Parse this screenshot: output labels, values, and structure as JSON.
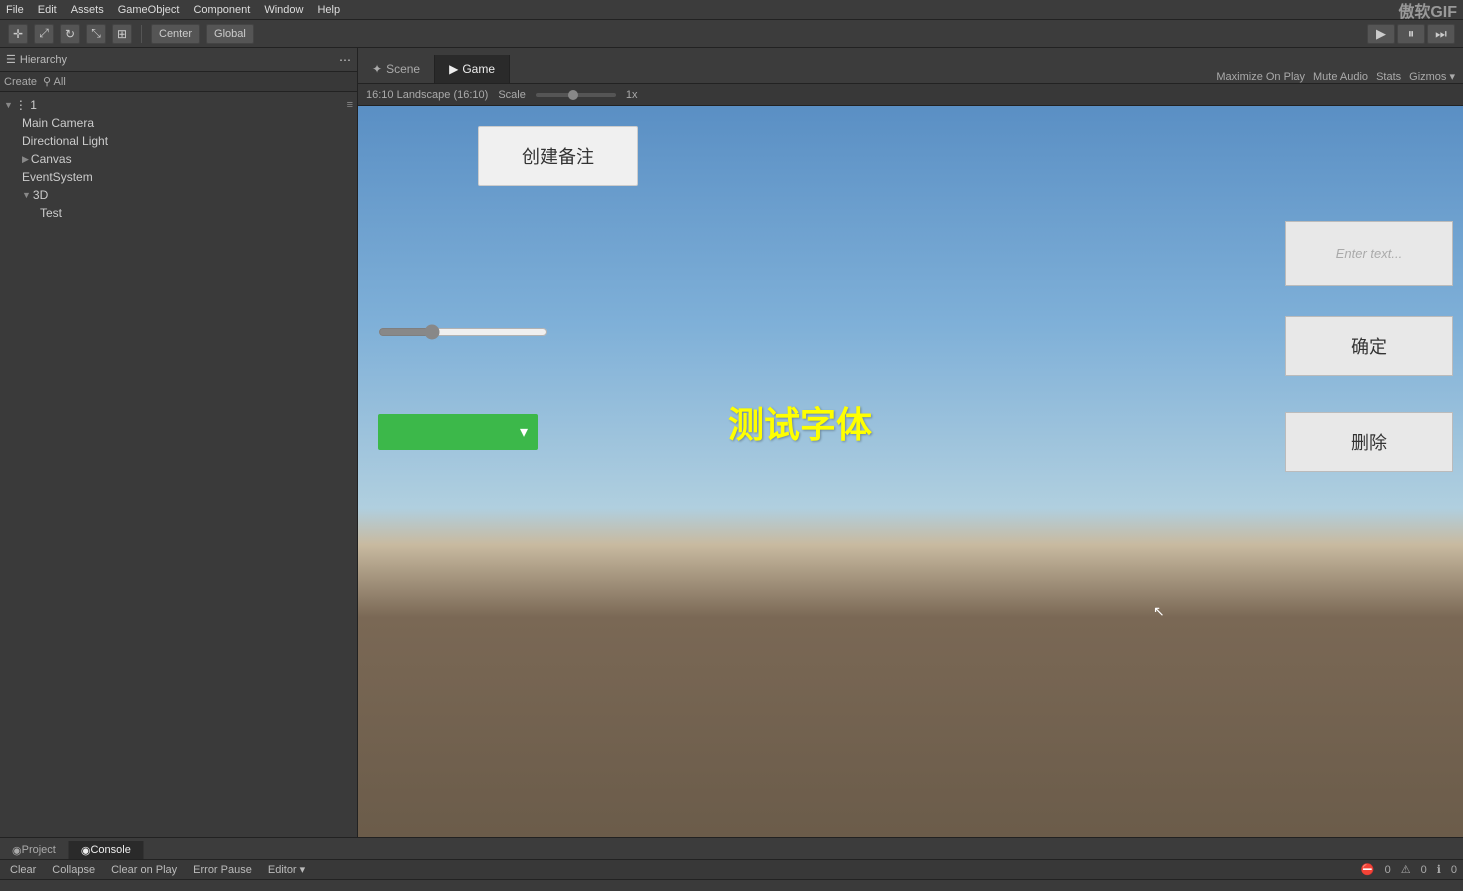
{
  "menubar": {
    "items": [
      "File",
      "Edit",
      "Assets",
      "GameObject",
      "Component",
      "Window",
      "Help"
    ]
  },
  "toolbar": {
    "transform_tools": [
      "✛",
      "⤢",
      "↻",
      "⤡",
      "⊞"
    ],
    "center_label": "Center",
    "global_label": "Global",
    "play_icon": "▶",
    "pause_icon": "⏸",
    "step_icon": "⏭",
    "brand": "傲软GIF"
  },
  "hierarchy": {
    "title": "Hierarchy",
    "create_label": "Create",
    "all_label": "⚲ All",
    "items": [
      {
        "label": "1",
        "indent": 0,
        "arrow": "▼",
        "id": "scene-1"
      },
      {
        "label": "Main Camera",
        "indent": 1,
        "arrow": "",
        "id": "main-camera"
      },
      {
        "label": "Directional Light",
        "indent": 1,
        "arrow": "",
        "id": "dir-light"
      },
      {
        "label": "Canvas",
        "indent": 1,
        "arrow": "▶",
        "id": "canvas"
      },
      {
        "label": "EventSystem",
        "indent": 1,
        "arrow": "",
        "id": "event-system"
      },
      {
        "label": "3D",
        "indent": 1,
        "arrow": "▼",
        "id": "3d"
      },
      {
        "label": "Test",
        "indent": 2,
        "arrow": "",
        "id": "test"
      }
    ]
  },
  "scene_tabs": {
    "tabs": [
      {
        "label": "Scene",
        "icon": "✦",
        "active": false
      },
      {
        "label": "Game",
        "icon": "▶",
        "active": true
      }
    ],
    "right_options": [
      "Maximize On Play",
      "Mute Audio",
      "Stats",
      "Gizmos ▾"
    ]
  },
  "game_toolbar": {
    "resolution": "16:10 Landscape (16:10)",
    "scale_label": "Scale",
    "scale_value": "1x"
  },
  "game_view": {
    "create_note_btn": "创建备注",
    "enter_text_placeholder": "Enter text...",
    "confirm_btn": "确定",
    "delete_btn": "删除",
    "test_text": "测试字体"
  },
  "bottom": {
    "tabs": [
      {
        "label": "Project",
        "icon": "◉",
        "active": false
      },
      {
        "label": "Console",
        "icon": "◉",
        "active": true
      }
    ],
    "toolbar_btns": [
      "Clear",
      "Collapse",
      "Clear on Play",
      "Error Pause",
      "Editor ▾"
    ],
    "status": {
      "error_count": "0",
      "warn_count": "0",
      "info_count": "0"
    }
  }
}
